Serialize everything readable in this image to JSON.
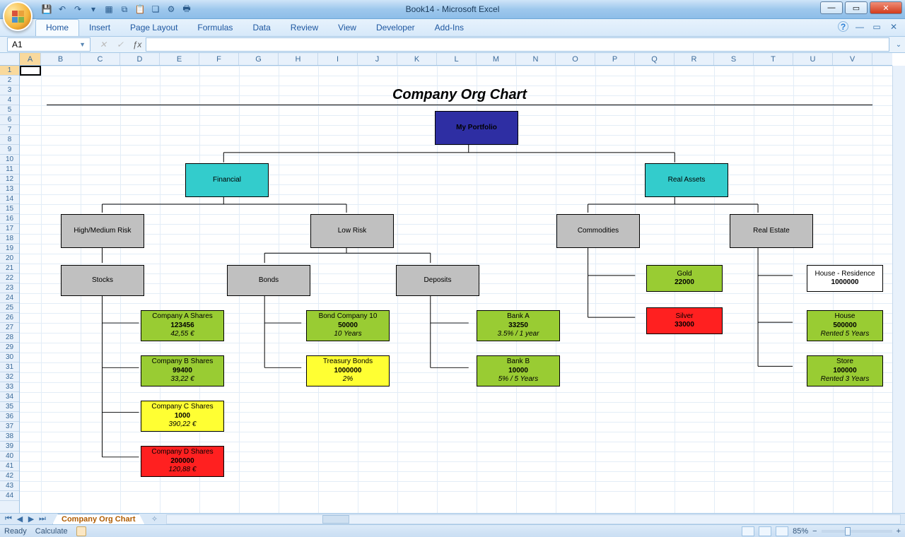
{
  "window": {
    "title": "Book14 - Microsoft Excel"
  },
  "qat_icons": [
    "save-icon",
    "undo-icon",
    "redo-icon",
    "repeat-icon",
    "grid-icon",
    "copy-icon",
    "paste-icon",
    "calc-icon",
    "chart-icon",
    "print-icon"
  ],
  "ribbon_tabs": [
    "Home",
    "Insert",
    "Page Layout",
    "Formulas",
    "Data",
    "Review",
    "View",
    "Developer",
    "Add-Ins"
  ],
  "active_ribbon_tab": 0,
  "namebox": "A1",
  "formula": "",
  "columns": [
    "A",
    "B",
    "C",
    "D",
    "E",
    "F",
    "G",
    "H",
    "I",
    "J",
    "K",
    "L",
    "M",
    "N",
    "O",
    "P",
    "Q",
    "R",
    "S",
    "T",
    "U",
    "V"
  ],
  "rows": [
    "1",
    "2",
    "3",
    "4",
    "5",
    "6",
    "7",
    "8",
    "9",
    "10",
    "11",
    "12",
    "13",
    "14",
    "15",
    "16",
    "17",
    "18",
    "19",
    "20",
    "21",
    "22",
    "23",
    "24",
    "25",
    "26",
    "27",
    "28",
    "29",
    "30",
    "31",
    "32",
    "33",
    "34",
    "35",
    "36",
    "37",
    "38",
    "39",
    "40",
    "41",
    "42",
    "43",
    "44"
  ],
  "sheet_tab": "Company Org Chart",
  "status": {
    "ready": "Ready",
    "calculate": "Calculate",
    "zoom": "85%"
  },
  "chart": {
    "title": "Company Org Chart",
    "nodes": {
      "root": {
        "label": "My Portfolio"
      },
      "financial": {
        "label": "Financial"
      },
      "realassets": {
        "label": "Real Assets"
      },
      "hmrisk": {
        "label": "High/Medium Risk"
      },
      "lowrisk": {
        "label": "Low Risk"
      },
      "commodities": {
        "label": "Commodities"
      },
      "realestate": {
        "label": "Real Estate"
      },
      "stocks": {
        "label": "Stocks"
      },
      "bonds": {
        "label": "Bonds"
      },
      "deposits": {
        "label": "Deposits"
      },
      "gold": {
        "label": "Gold",
        "v": "22000"
      },
      "silver": {
        "label": "Silver",
        "v": "33000"
      },
      "housres": {
        "label": "House - Residence",
        "v": "1000000"
      },
      "house": {
        "label": "House",
        "v": "500000",
        "note": "Rented 5 Years"
      },
      "store": {
        "label": "Store",
        "v": "100000",
        "note": "Rented 3 Years"
      },
      "compA": {
        "label": "Company A Shares",
        "v": "123456",
        "note": "42,55 €"
      },
      "compB": {
        "label": "Company B Shares",
        "v": "99400",
        "note": "33,22 €"
      },
      "compC": {
        "label": "Company C Shares",
        "v": "1000",
        "note": "390,22 €"
      },
      "compD": {
        "label": "Company D Shares",
        "v": "200000",
        "note": "120,88 €"
      },
      "bond10": {
        "label": "Bond Company 10",
        "v": "50000",
        "note": "10 Years"
      },
      "tbonds": {
        "label": "Treasury Bonds",
        "v": "1000000",
        "note": "2%"
      },
      "bankA": {
        "label": "Bank A",
        "v": "33250",
        "note": "3.5% / 1 year"
      },
      "bankB": {
        "label": "Bank B",
        "v": "10000",
        "note": "5% / 5 Years"
      }
    }
  },
  "chart_data": {
    "type": "tree",
    "title": "Company Org Chart",
    "root": {
      "name": "My Portfolio",
      "children": [
        {
          "name": "Financial",
          "children": [
            {
              "name": "High/Medium Risk",
              "children": [
                {
                  "name": "Stocks",
                  "children": [
                    {
                      "name": "Company A Shares",
                      "value": 123456,
                      "price": "42,55 €",
                      "color": "green"
                    },
                    {
                      "name": "Company B Shares",
                      "value": 99400,
                      "price": "33,22 €",
                      "color": "green"
                    },
                    {
                      "name": "Company C Shares",
                      "value": 1000,
                      "price": "390,22 €",
                      "color": "yellow"
                    },
                    {
                      "name": "Company D Shares",
                      "value": 200000,
                      "price": "120,88 €",
                      "color": "red"
                    }
                  ]
                }
              ]
            },
            {
              "name": "Low Risk",
              "children": [
                {
                  "name": "Bonds",
                  "children": [
                    {
                      "name": "Bond Company 10",
                      "value": 50000,
                      "note": "10 Years",
                      "color": "green"
                    },
                    {
                      "name": "Treasury Bonds",
                      "value": 1000000,
                      "note": "2%",
                      "color": "yellow"
                    }
                  ]
                },
                {
                  "name": "Deposits",
                  "children": [
                    {
                      "name": "Bank A",
                      "value": 33250,
                      "note": "3.5% / 1 year",
                      "color": "green"
                    },
                    {
                      "name": "Bank B",
                      "value": 10000,
                      "note": "5% / 5 Years",
                      "color": "green"
                    }
                  ]
                }
              ]
            }
          ]
        },
        {
          "name": "Real Assets",
          "children": [
            {
              "name": "Commodities",
              "children": [
                {
                  "name": "Gold",
                  "value": 22000,
                  "color": "green"
                },
                {
                  "name": "Silver",
                  "value": 33000,
                  "color": "red"
                }
              ]
            },
            {
              "name": "Real Estate",
              "children": [
                {
                  "name": "House - Residence",
                  "value": 1000000,
                  "color": "white"
                },
                {
                  "name": "House",
                  "value": 500000,
                  "note": "Rented 5 Years",
                  "color": "green"
                },
                {
                  "name": "Store",
                  "value": 100000,
                  "note": "Rented 3 Years",
                  "color": "green"
                }
              ]
            }
          ]
        }
      ]
    }
  }
}
